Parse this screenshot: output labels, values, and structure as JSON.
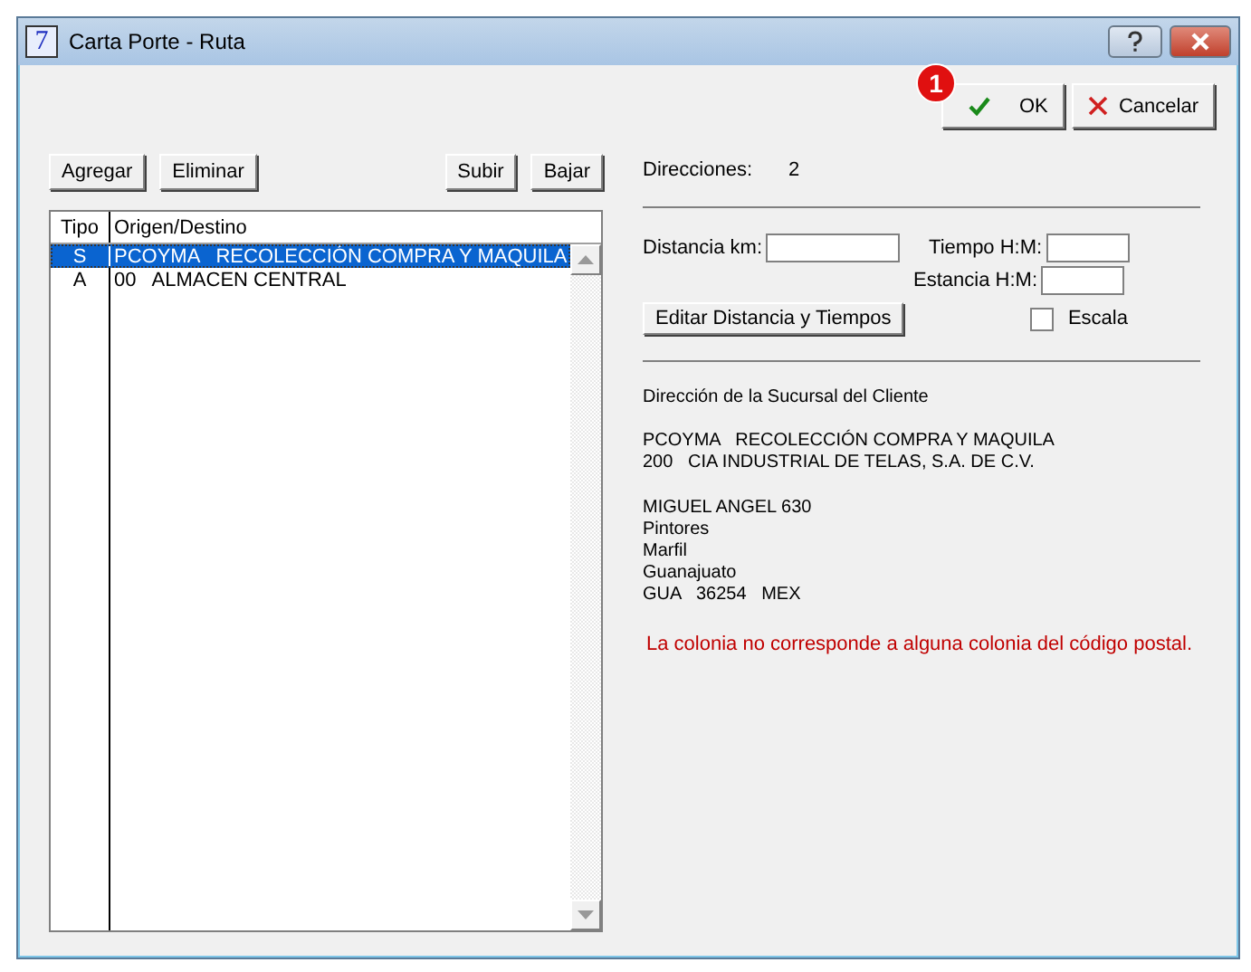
{
  "window": {
    "title": "Carta Porte - Ruta",
    "app_icon": "7"
  },
  "header_buttons": [
    {
      "label": "OK",
      "kind": "ok",
      "badge": "1"
    },
    {
      "label": "Cancelar",
      "kind": "cancel"
    }
  ],
  "list_buttons_left": [
    "Agregar",
    "Eliminar"
  ],
  "list_buttons_right": [
    "Subir",
    "Bajar"
  ],
  "table": {
    "columns": [
      "Tipo",
      "Origen/Destino"
    ],
    "rows": [
      {
        "tipo": "S",
        "origen_destino": "PCOYMA   RECOLECCIÓN COMPRA Y MAQUILA",
        "selected": true
      },
      {
        "tipo": "A",
        "origen_destino": "00   ALMACEN CENTRAL",
        "selected": false
      }
    ]
  },
  "direcciones": {
    "label": "Direcciones:",
    "value": "2"
  },
  "distancia": {
    "label": "Distancia km:"
  },
  "tiempo": {
    "label": "Tiempo H:M:"
  },
  "estancia": {
    "label": "Estancia H:M:"
  },
  "edit_button": "Editar Distancia y Tiempos",
  "escala": {
    "label": "Escala",
    "checked": false
  },
  "address": {
    "heading": "Dirección de la Sucursal del Cliente",
    "lines_1": [
      "PCOYMA   RECOLECCIÓN COMPRA Y MAQUILA",
      "200   CIA INDUSTRIAL DE TELAS, S.A. DE C.V."
    ],
    "lines_2": [
      "MIGUEL ANGEL 630",
      "Pintores",
      "Marfil",
      "Guanajuato",
      "GUA   36254   MEX"
    ]
  },
  "warning": "La colonia no corresponde a alguna colonia del código postal."
}
